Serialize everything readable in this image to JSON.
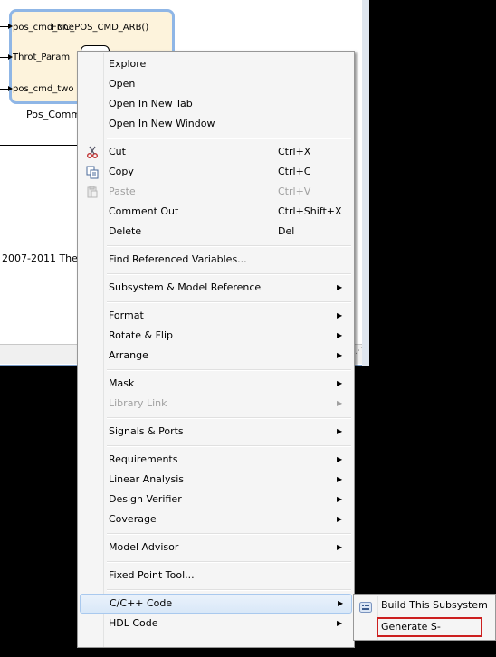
{
  "canvas": {
    "block_title": "FNC_POS_CMD_ARB()",
    "ports": [
      "pos_cmd_one",
      "Throt_Param",
      "pos_cmd_two"
    ],
    "block_name": "Pos_Comm",
    "copyright": "2007-2011 The"
  },
  "menu": {
    "items": [
      {
        "label": "Explore"
      },
      {
        "label": "Open"
      },
      {
        "label": "Open In New Tab"
      },
      {
        "label": "Open In New Window"
      },
      {
        "label": "Cut",
        "shortcut": "Ctrl+X",
        "icon": "scissors-icon"
      },
      {
        "label": "Copy",
        "shortcut": "Ctrl+C",
        "icon": "copy-icon"
      },
      {
        "label": "Paste",
        "shortcut": "Ctrl+V",
        "icon": "paste-icon",
        "disabled": true
      },
      {
        "label": "Comment Out",
        "shortcut": "Ctrl+Shift+X"
      },
      {
        "label": "Delete",
        "shortcut": "Del"
      },
      {
        "label": "Find Referenced Variables..."
      },
      {
        "label": "Subsystem & Model Reference",
        "submenu": true
      },
      {
        "label": "Format",
        "submenu": true
      },
      {
        "label": "Rotate & Flip",
        "submenu": true
      },
      {
        "label": "Arrange",
        "submenu": true
      },
      {
        "label": "Mask",
        "submenu": true
      },
      {
        "label": "Library Link",
        "submenu": true,
        "disabled": true
      },
      {
        "label": "Signals & Ports",
        "submenu": true
      },
      {
        "label": "Requirements",
        "submenu": true
      },
      {
        "label": "Linear Analysis",
        "submenu": true
      },
      {
        "label": "Design Verifier",
        "submenu": true
      },
      {
        "label": "Coverage",
        "submenu": true
      },
      {
        "label": "Model Advisor",
        "submenu": true
      },
      {
        "label": "Fixed Point Tool..."
      },
      {
        "label": "C/C++ Code",
        "submenu": true,
        "highlighted": true
      },
      {
        "label": "HDL Code",
        "submenu": true
      }
    ],
    "submenu_arrow": "▶"
  },
  "submenu": {
    "items": [
      {
        "label": "Build This Subsystem",
        "icon": "build-icon"
      },
      {
        "label": "Generate S-Function",
        "boxed": true
      }
    ]
  },
  "colors": {
    "highlight_box": "#cc1f1f",
    "block_fill": "#fdf3dc",
    "block_border": "#8fb6e6"
  }
}
